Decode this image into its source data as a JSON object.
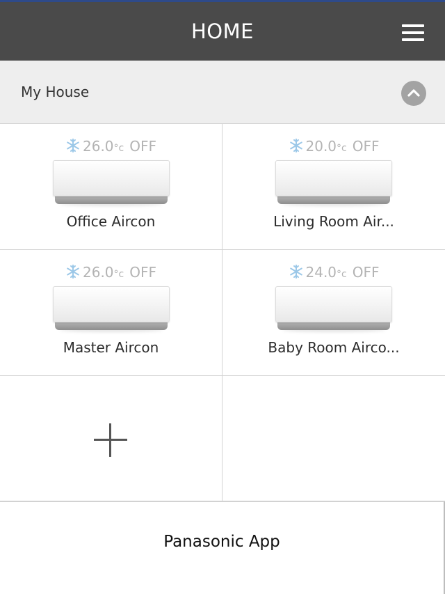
{
  "header": {
    "title": "HOME",
    "menu_icon": "hamburger-menu-icon"
  },
  "group": {
    "name": "My House",
    "collapse_icon": "chevron-up-icon"
  },
  "devices": [
    {
      "temp": "26.0",
      "unit": "°c",
      "state": "OFF",
      "name": "Office Aircon",
      "mode_icon": "snowflake-icon"
    },
    {
      "temp": "20.0",
      "unit": "°c",
      "state": "OFF",
      "name": "Living Room Air...",
      "mode_icon": "snowflake-icon"
    },
    {
      "temp": "26.0",
      "unit": "°c",
      "state": "OFF",
      "name": "Master Aircon",
      "mode_icon": "snowflake-icon"
    },
    {
      "temp": "24.0",
      "unit": "°c",
      "state": "OFF",
      "name": "Baby Room Airco...",
      "mode_icon": "snowflake-icon"
    }
  ],
  "add_button": {
    "icon": "plus-icon"
  },
  "footer": {
    "label": "Panasonic App"
  },
  "colors": {
    "header_bg": "#4a4a4a",
    "group_bg": "#eeeeee",
    "status_text": "#b3b3b3",
    "snowflake": "#9cc8e8"
  }
}
